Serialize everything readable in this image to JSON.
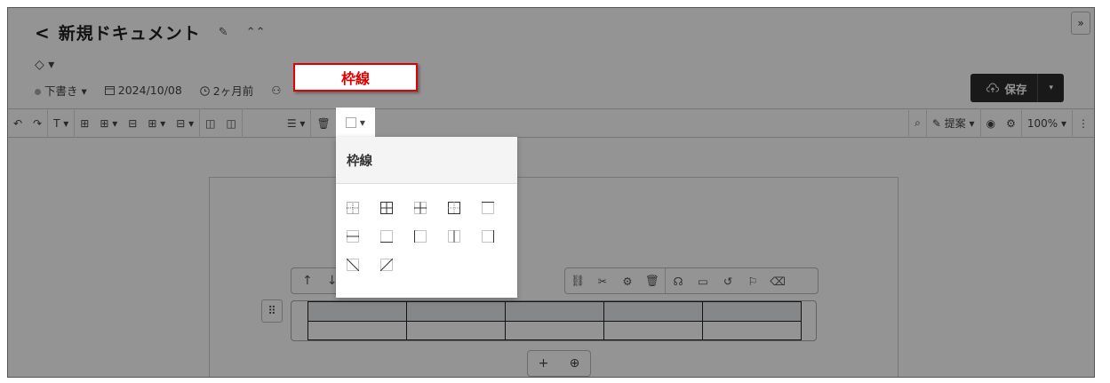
{
  "header": {
    "back_glyph": "<",
    "title": "新規ドキュメント",
    "edit_glyph": "✎",
    "collapse_glyph": "⌃⌃",
    "tag_glyph": "◇ ▾",
    "status": "下書き",
    "status_caret": "▾",
    "date": "2024/10/08",
    "relative_time": "2ヶ月前",
    "save_label": "保存",
    "save_caret": "▾",
    "expand_glyph": "»"
  },
  "toolbar": {
    "undo": "↶",
    "redo": "↷",
    "text_style": "T ▾",
    "zoom_label": "100%",
    "zoom_caret": "▾",
    "suggest_label": "提案",
    "suggest_caret": "▾",
    "more_glyph": "⋮"
  },
  "dropdown": {
    "title": "枠線",
    "options": [
      "border-inner-dotted-icon",
      "border-all-icon",
      "border-inner-icon",
      "border-outer-icon",
      "border-top-icon",
      "border-horizontal-icon",
      "border-bottom-icon",
      "border-vertical-icon",
      "border-left-right-icon",
      "border-right-icon",
      "border-diagonal-down-icon",
      "border-diagonal-up-icon"
    ]
  },
  "table_controls": {
    "up": "↑",
    "down": "↓",
    "drag": "⠿",
    "add": "+",
    "add_block": "⊕"
  },
  "callout": {
    "label": "枠線"
  },
  "colors": {
    "accent_red": "#e00000",
    "save_bg": "#2b2b2b"
  }
}
